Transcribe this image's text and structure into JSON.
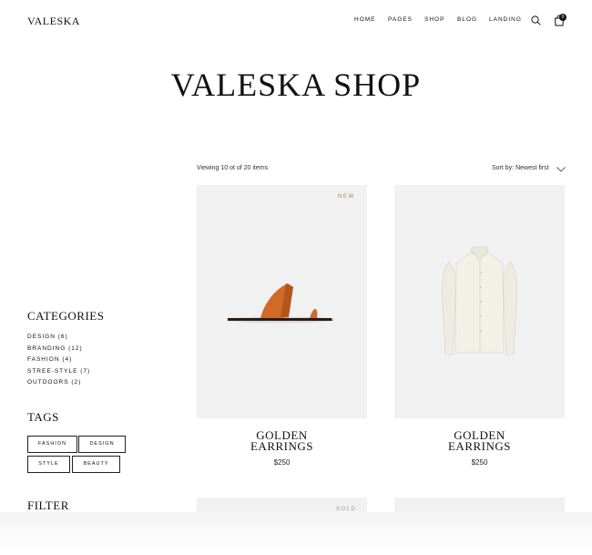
{
  "header": {
    "logo": "VALESKA",
    "nav": [
      "HOME",
      "PAGES",
      "SHOP",
      "BLOG",
      "LANDING"
    ],
    "cart_count": "0",
    "icons": [
      "search-icon",
      "shopping-bag-icon"
    ]
  },
  "page": {
    "title": "VALESKA SHOP"
  },
  "toolbar": {
    "viewing": "Viewing 10 ot of 20 items",
    "sort": "Sort by: Newest first"
  },
  "sidebar": {
    "categories_heading": "CATEGORIES",
    "categories": [
      "DESIGN (6)",
      "BRANDING (12)",
      "FASHION (4)",
      "STREE-STYLE (7)",
      "OUTDOORS (2)"
    ],
    "tags_heading": "TAGS",
    "tags": [
      "FASHION",
      "DESIGN",
      "STYLE",
      "BEAUTY"
    ],
    "filter_heading": "FILTER"
  },
  "products": [
    {
      "label": "NEW",
      "name_line1": "GOLDEN",
      "name_line2": "EARRINGS",
      "price": "$250",
      "label_color": "#a08a4a"
    },
    {
      "label": "",
      "name_line1": "GOLDEN",
      "name_line2": "EARRINGS",
      "price": "$250"
    },
    {
      "label": "SOLD",
      "label_color": "#999999"
    }
  ]
}
